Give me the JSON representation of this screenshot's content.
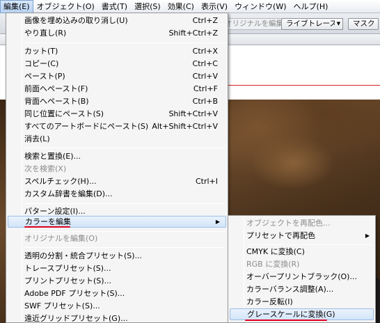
{
  "menubar": {
    "items": [
      {
        "label": "編集(E)"
      },
      {
        "label": "オブジェクト(O)"
      },
      {
        "label": "書式(T)"
      },
      {
        "label": "選択(S)"
      },
      {
        "label": "効果(C)"
      },
      {
        "label": "表示(V)"
      },
      {
        "label": "ウィンドウ(W)"
      },
      {
        "label": "ヘルプ(H)"
      }
    ]
  },
  "controlbar": {
    "edit_original": "オリジナルを編集",
    "live_trace": "ライブトレース",
    "mask": "マスク"
  },
  "edit_menu": {
    "items": [
      {
        "label": "画像を埋め込みの取り消し(U)",
        "shortcut": "Ctrl+Z"
      },
      {
        "label": "やり直し(R)",
        "shortcut": "Shift+Ctrl+Z"
      },
      {
        "label": "カット(T)",
        "shortcut": "Ctrl+X"
      },
      {
        "label": "コピー(C)",
        "shortcut": "Ctrl+C"
      },
      {
        "label": "ペースト(P)",
        "shortcut": "Ctrl+V"
      },
      {
        "label": "前面へペースト(F)",
        "shortcut": "Ctrl+F"
      },
      {
        "label": "背面へペースト(B)",
        "shortcut": "Ctrl+B"
      },
      {
        "label": "同じ位置にペースト(S)",
        "shortcut": "Shift+Ctrl+V"
      },
      {
        "label": "すべてのアートボードにペースト(S)",
        "shortcut": "Alt+Shift+Ctrl+V"
      },
      {
        "label": "消去(L)",
        "shortcut": ""
      },
      {
        "label": "検索と置換(E)...",
        "shortcut": ""
      },
      {
        "label": "次を検索(X)",
        "shortcut": "",
        "disabled": true
      },
      {
        "label": "スペルチェック(H)...",
        "shortcut": "Ctrl+I"
      },
      {
        "label": "カスタム辞書を編集(D)...",
        "shortcut": ""
      },
      {
        "label": "パターン設定(I)...",
        "shortcut": ""
      },
      {
        "label": "カラーを編集",
        "shortcut": "",
        "submenu": true,
        "highlighted": true
      },
      {
        "label": "オリジナルを編集(O)",
        "shortcut": "",
        "disabled": true
      },
      {
        "label": "透明の分割・統合プリセット(S)...",
        "shortcut": ""
      },
      {
        "label": "トレースプリセット(S)...",
        "shortcut": ""
      },
      {
        "label": "プリントプリセット(S)...",
        "shortcut": ""
      },
      {
        "label": "Adobe PDF プリセット(S)...",
        "shortcut": ""
      },
      {
        "label": "SWF プリセット(S)...",
        "shortcut": ""
      },
      {
        "label": "遠近グリッドプリセット(G)...",
        "shortcut": ""
      }
    ]
  },
  "color_submenu": {
    "items": [
      {
        "label": "オブジェクトを再配色...",
        "disabled": true
      },
      {
        "label": "プリセットで再配色",
        "submenu": true
      },
      {
        "label": "CMYK に変換(C)"
      },
      {
        "label": "RGB に変換(R)",
        "disabled": true
      },
      {
        "label": "オーバープリントブラック(O)..."
      },
      {
        "label": "カラーバランス調整(A)..."
      },
      {
        "label": "カラー反転(I)"
      },
      {
        "label": "グレースケールに変換(G)",
        "highlighted": true
      }
    ]
  },
  "colors": {
    "highlight_underline": "#e0001e"
  },
  "glyphs": {
    "submenu_arrow": "▶",
    "dropdown_arrow": "▼"
  }
}
